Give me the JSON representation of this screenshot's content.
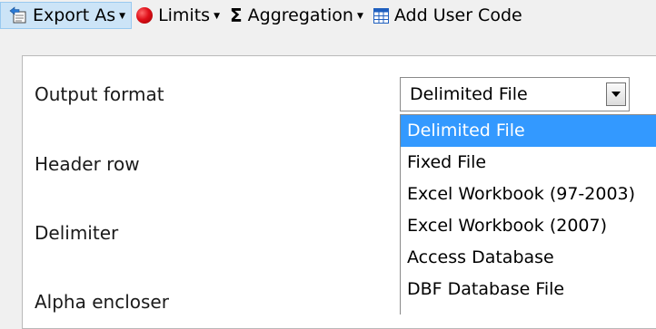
{
  "toolbar": {
    "export_label": "Export As",
    "limits_label": "Limits",
    "aggregation_label": "Aggregation",
    "add_user_code_label": "Add User Code",
    "sigma_glyph": "Σ",
    "arrow_glyph": "▼"
  },
  "form": {
    "labels": {
      "output_format": "Output format",
      "header_row": "Header row",
      "delimiter": "Delimiter",
      "alpha_encloser": "Alpha encloser"
    },
    "output_format_value": "Delimited File",
    "options": [
      "Delimited File",
      "Fixed File",
      "Excel Workbook (97-2003)",
      "Excel Workbook (2007)",
      "Access Database",
      "DBF Database File"
    ],
    "selected_index": 0
  },
  "colors": {
    "highlight": "#3399ff",
    "toolbar_hover": "#cce4f7",
    "stop_red": "#e0101a"
  }
}
